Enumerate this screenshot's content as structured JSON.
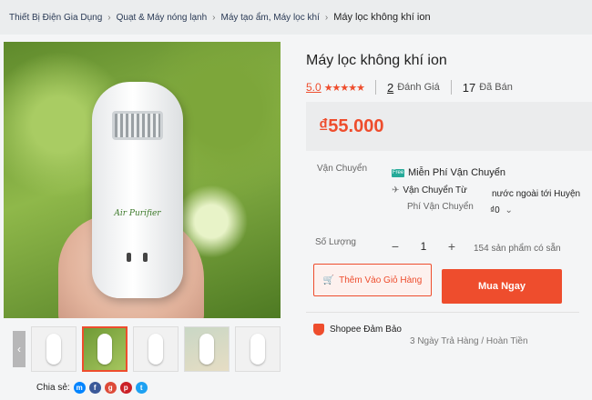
{
  "breadcrumb": {
    "items": [
      "Thiết Bị Điện Gia Dụng",
      "Quạt & Máy nóng lạnh",
      "Máy tạo ẩm, Máy lọc khí"
    ],
    "current": "Máy lọc không khí ion"
  },
  "gallery": {
    "device_brand": "Air Purifier"
  },
  "product": {
    "title": "Máy lọc không khí ion",
    "rating": "5.0",
    "stars": "★★★★★",
    "review_count": "2",
    "review_label": "Đánh Giá",
    "sold_count": "17",
    "sold_label": "Đã Bán",
    "price": "₫55.000"
  },
  "shipping": {
    "label": "Vận Chuyển",
    "free_badge": "Free",
    "free_text": "Miễn Phí Vận Chuyển",
    "from_label": "Vận Chuyển Từ",
    "from_value": "nước ngoài tới Huyện",
    "fee_label": "Phí Vận Chuyển",
    "fee_value": "₫0"
  },
  "quantity": {
    "label": "Số Lượng",
    "minus": "−",
    "value": "1",
    "plus": "+",
    "stock": "154 sản phẩm có sẵn"
  },
  "actions": {
    "add_to_cart": "Thêm Vào Giỏ Hàng",
    "buy_now": "Mua Ngay"
  },
  "guarantee": {
    "label": "Shopee Đảm Bảo",
    "note": "3 Ngày Trả Hàng / Hoàn Tiền"
  },
  "share": {
    "label": "Chia sẻ:"
  },
  "colors": {
    "accent": "#ee4d2d",
    "free_ship": "#26aa99"
  }
}
